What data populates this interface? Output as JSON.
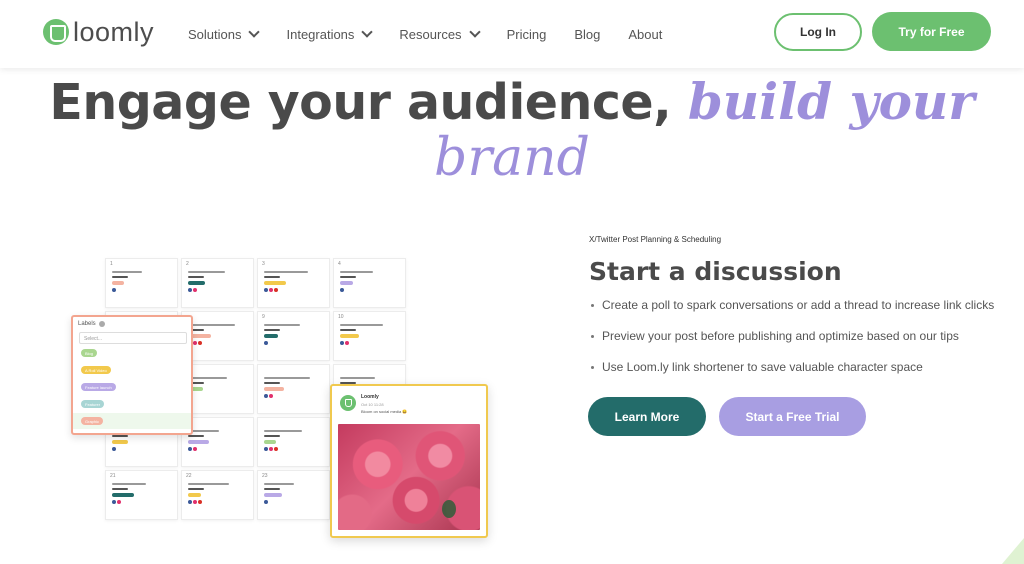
{
  "nav": {
    "logo_text": "loomly",
    "items": [
      {
        "label": "Solutions",
        "dropdown": true
      },
      {
        "label": "Integrations",
        "dropdown": true
      },
      {
        "label": "Resources",
        "dropdown": true
      },
      {
        "label": "Pricing",
        "dropdown": false
      },
      {
        "label": "Blog",
        "dropdown": false
      },
      {
        "label": "About",
        "dropdown": false
      }
    ],
    "login_label": "Log In",
    "try_label": "Try for Free"
  },
  "hero": {
    "headline_strong": "Engage your audience, ",
    "headline_em_1": "build your",
    "headline_em_2": "brand"
  },
  "mockup": {
    "day_numbers": [
      "1",
      "2",
      "3",
      "4",
      "",
      "",
      "9",
      "10",
      "",
      "",
      "",
      "",
      "",
      "",
      "",
      "",
      "21",
      "22",
      "23",
      ""
    ],
    "labels_panel": {
      "title": "Labels",
      "select_placeholder": "Select...",
      "tags": [
        {
          "label": "Blog",
          "color": "#a9d68f"
        },
        {
          "label": "A Roll Video",
          "color": "#f2c94c"
        },
        {
          "label": "Feature launch",
          "color": "#b9a9e6"
        },
        {
          "label": "Featurer",
          "color": "#a8d5d4"
        },
        {
          "label": "Graphic",
          "color": "#f4b3a1"
        }
      ]
    },
    "post": {
      "name": "Loomly",
      "date": "Oct 10 11:28",
      "text": "Bloom on social media 😀"
    }
  },
  "content": {
    "eyebrow": "X/Twitter Post Planning & Scheduling",
    "title": "Start a discussion",
    "bullets": [
      "Create a poll to spark conversations or add a thread to increase link clicks",
      "Preview your post before publishing and optimize based on our tips",
      "Use Loom.ly link shortener to save valuable character space"
    ],
    "learn_more_label": "Learn More",
    "free_trial_label": "Start a Free Trial"
  },
  "colors": {
    "brand_green": "#6cc070",
    "accent_purple": "#9d8fdb",
    "teal_button": "#236c6a",
    "lavender_button": "#a89ee2"
  }
}
